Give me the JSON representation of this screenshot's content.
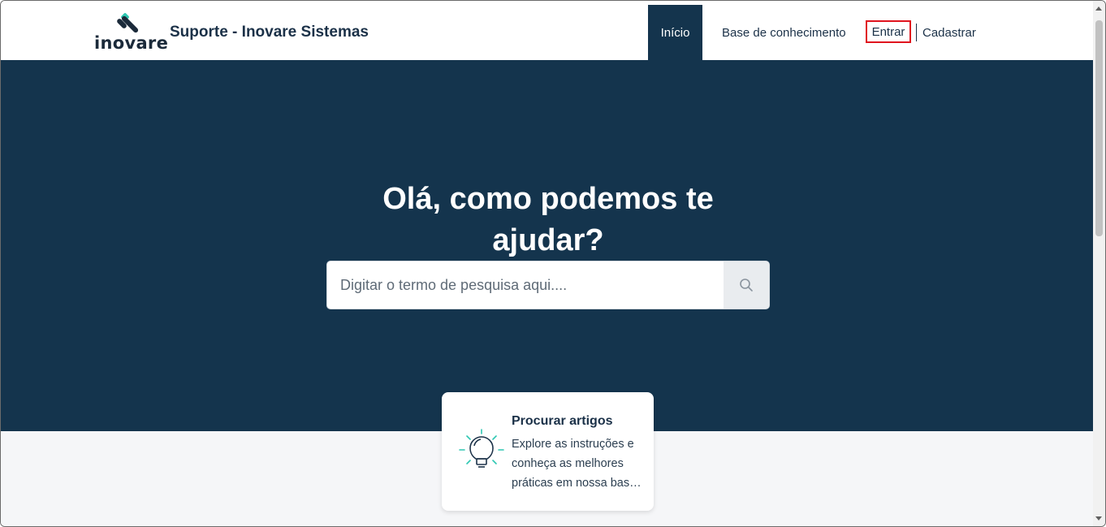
{
  "header": {
    "logo_text": "inovare",
    "site_title": "Suporte - Inovare Sistemas",
    "nav": {
      "home": "Início",
      "knowledge_base": "Base de conhecimento",
      "login": "Entrar",
      "register": "Cadastrar"
    }
  },
  "hero": {
    "title": "Olá, como podemos te ajudar?",
    "search": {
      "placeholder": "Digitar o termo de pesquisa aqui...."
    }
  },
  "cards": [
    {
      "title": "Procurar artigos",
      "description": "Explore as instruções e conheça as melhores práticas em nossa base de conhecimento."
    }
  ],
  "colors": {
    "brand_dark": "#14344d",
    "accent_teal": "#2fc7b2",
    "highlight_red": "#e0141e"
  },
  "icons": {
    "search": "search-icon",
    "card": "lightbulb-icon"
  }
}
